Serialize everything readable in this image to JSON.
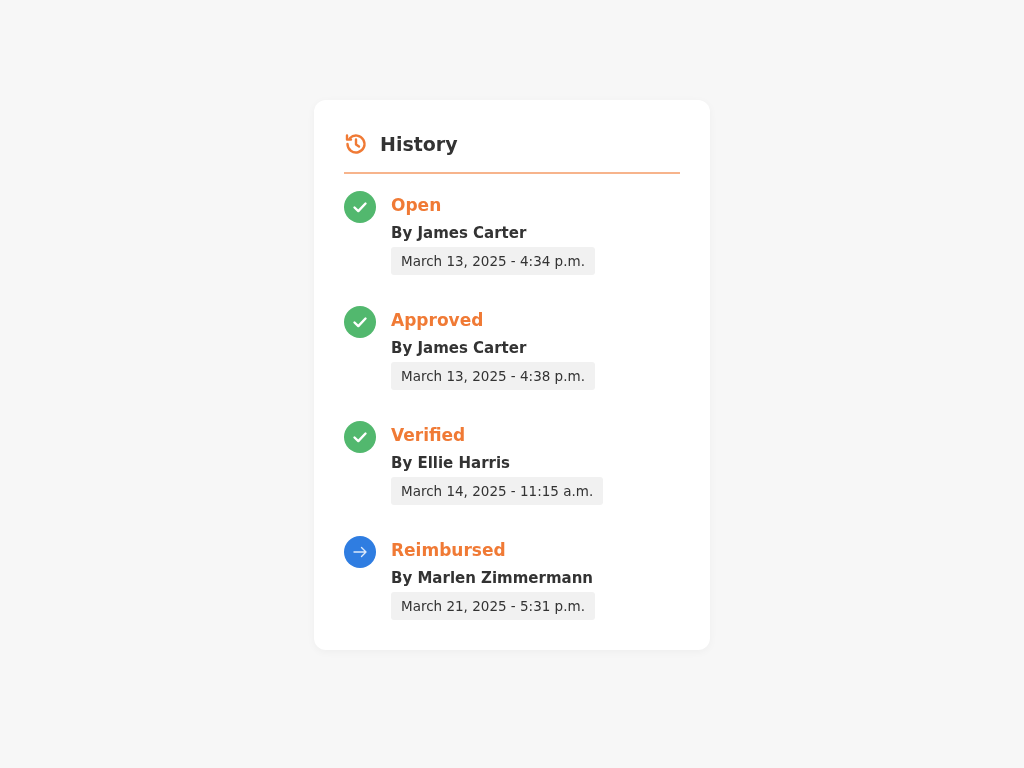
{
  "title": "History",
  "events": [
    {
      "status": "Open",
      "by": "By James Carter",
      "date": "March 13, 2025 - 4:34 p.m.",
      "kind": "done"
    },
    {
      "status": "Approved",
      "by": "By James Carter",
      "date": "March 13, 2025 - 4:38 p.m.",
      "kind": "done"
    },
    {
      "status": "Verified",
      "by": "By Ellie Harris",
      "date": "March 14, 2025 - 11:15 a.m.",
      "kind": "done"
    },
    {
      "status": "Reimbursed",
      "by": "By Marlen Zimmermann",
      "date": "March 21, 2025 - 5:31 p.m.",
      "kind": "current"
    }
  ]
}
